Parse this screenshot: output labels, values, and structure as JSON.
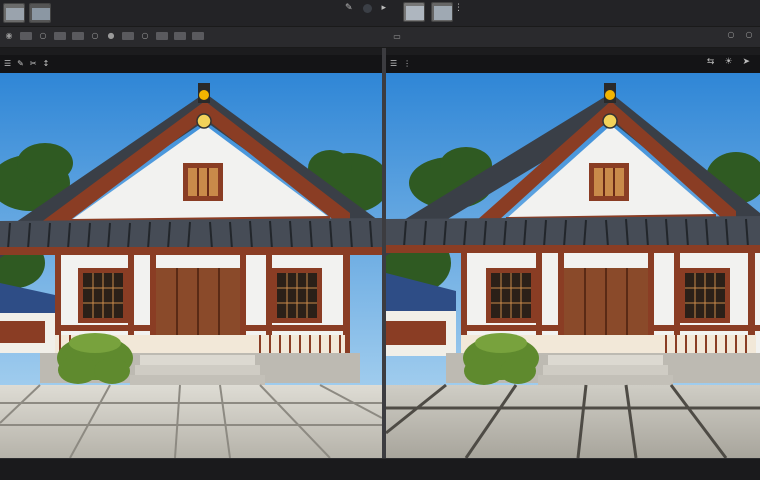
{
  "app": {
    "top_title": "",
    "thumbnails": [
      "image-thumbnail",
      "image-thumbnail"
    ]
  },
  "topbar_icons": [
    "pin-icon",
    "circle-icon"
  ],
  "toolbar_left_icons": [
    "zoom-icon",
    "brush-icon",
    "eraser-icon",
    "crop-icon",
    "move-icon",
    "layer-icon",
    "mask-icon",
    "filter-icon",
    "settings-icon",
    "adjust-icon",
    "text-icon",
    "shape-icon"
  ],
  "toolbar_right_icons": [
    "fit-icon",
    "zoom-out-icon",
    "zoom-in-icon"
  ],
  "pane_left_icons": [
    "layers-icon",
    "brush-icon",
    "eraser-icon",
    "move-icon"
  ],
  "pane_right_icons": [
    "compare-icon",
    "mirror-icon",
    "flip-icon",
    "sun-icon",
    "send-icon"
  ],
  "colors": {
    "sky_top": "#2f86d6",
    "sky_bottom": "#b9dcf3",
    "roof": "#3a3f47",
    "wood": "#8a3d24",
    "wall": "#f2f2f0",
    "bush": "#5f8a2e",
    "pavement": "#c9c7c0"
  }
}
